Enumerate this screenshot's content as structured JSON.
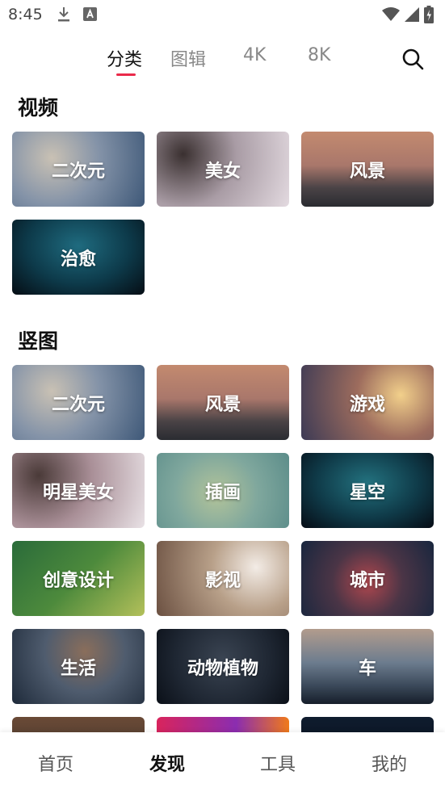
{
  "status": {
    "time": "8:45"
  },
  "tabs": [
    {
      "label": "分类"
    },
    {
      "label": "图辑"
    },
    {
      "label": "4K"
    },
    {
      "label": "8K"
    }
  ],
  "active_tab": "分类",
  "sections": {
    "video": {
      "title": "视频",
      "tiles": [
        {
          "label": "二次元"
        },
        {
          "label": "美女"
        },
        {
          "label": "风景"
        },
        {
          "label": "治愈"
        }
      ]
    },
    "portrait": {
      "title": "竖图",
      "tiles": [
        {
          "label": "二次元"
        },
        {
          "label": "风景"
        },
        {
          "label": "游戏"
        },
        {
          "label": "明星美女"
        },
        {
          "label": "插画"
        },
        {
          "label": "星空"
        },
        {
          "label": "创意设计"
        },
        {
          "label": "影视"
        },
        {
          "label": "城市"
        },
        {
          "label": "生活"
        },
        {
          "label": "动物植物"
        },
        {
          "label": "车"
        }
      ]
    }
  },
  "bottom_nav": [
    {
      "label": "首页"
    },
    {
      "label": "发现"
    },
    {
      "label": "工具"
    },
    {
      "label": "我的"
    }
  ],
  "active_nav": "发现",
  "colors": {
    "accent": "#ea2a4a",
    "text": "#111111",
    "muted": "#888888"
  }
}
